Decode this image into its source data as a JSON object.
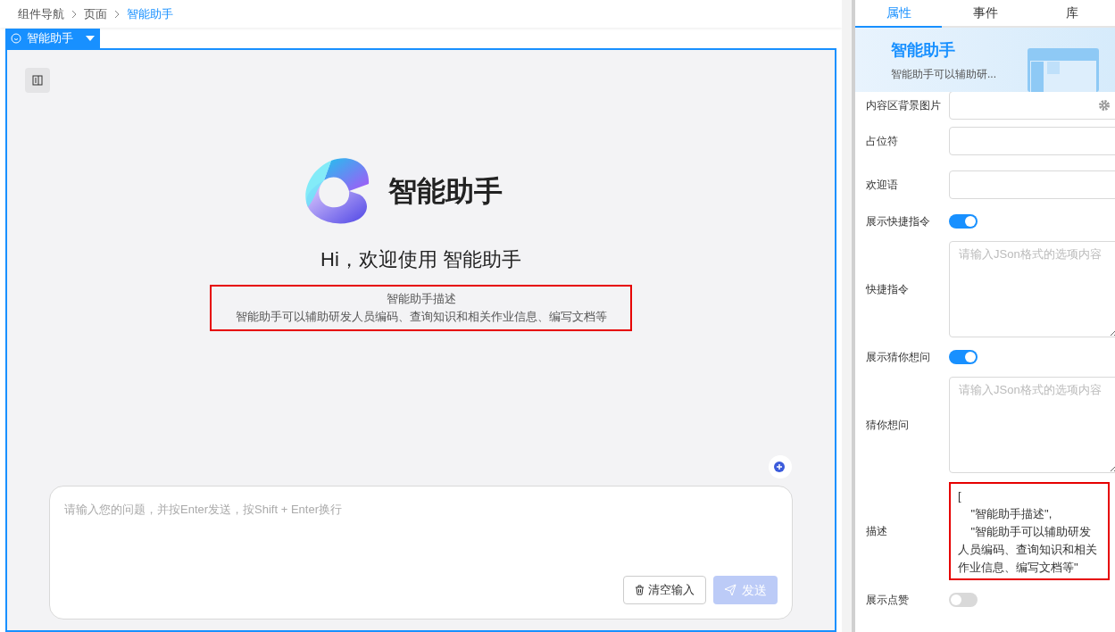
{
  "breadcrumb": [
    {
      "label": "组件导航",
      "current": false
    },
    {
      "label": "页面",
      "current": false
    },
    {
      "label": "智能助手",
      "current": true
    }
  ],
  "component_tag": {
    "label": "智能助手"
  },
  "canvas": {
    "title": "智能助手",
    "welcome": "Hi，欢迎使用 智能助手",
    "description": {
      "highlighted": true,
      "lines": [
        "智能助手描述",
        "智能助手可以辅助研发人员编码、查询知识和相关作业信息、编写文档等"
      ]
    },
    "input": {
      "placeholder": "请输入您的问题，并按Enter发送，按Shift + Enter换行"
    },
    "buttons": [
      {
        "kind": "clear",
        "label": "清空输入",
        "disabled": false
      },
      {
        "kind": "send",
        "label": "发送",
        "disabled": true
      }
    ]
  },
  "panel_tabs": [
    {
      "label": "属性",
      "selected": true
    },
    {
      "label": "事件",
      "selected": false
    },
    {
      "label": "库",
      "selected": false
    }
  ],
  "banner": {
    "title": "智能助手",
    "subtitle": "智能助手可以辅助研..."
  },
  "properties": [
    {
      "kind": "input",
      "label": "内容区背景图片",
      "gear": true
    },
    {
      "kind": "input",
      "label": "占位符",
      "gear": false
    },
    {
      "kind": "input",
      "label": "欢迎语",
      "gear": false
    },
    {
      "kind": "switch",
      "label": "展示快捷指令",
      "on": true
    },
    {
      "kind": "textarea",
      "label": "快捷指令",
      "placeholder": "请输入JSon格式的选项内容"
    },
    {
      "kind": "switch",
      "label": "展示猜你想问",
      "on": true
    },
    {
      "kind": "textarea",
      "label": "猜你想问",
      "placeholder": "请输入JSon格式的选项内容"
    },
    {
      "kind": "textarea",
      "label": "描述",
      "value": "[\n    \"智能助手描述\",\n    \"智能助手可以辅助研发人员编码、查询知识和相关作业信息、编写文档等\"",
      "highlighted": true
    },
    {
      "kind": "switch",
      "label": "展示点赞",
      "on": false
    }
  ]
}
